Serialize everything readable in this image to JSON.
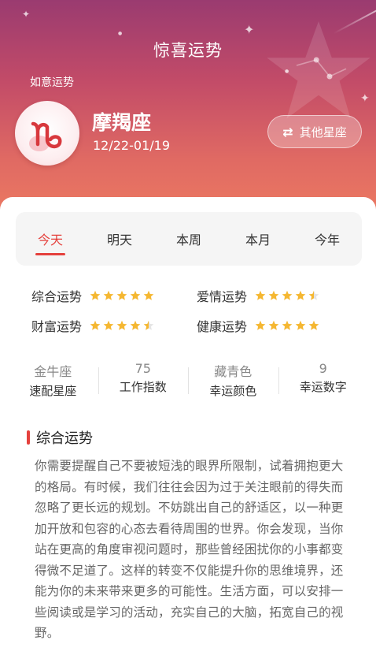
{
  "header": {
    "title": "惊喜运势",
    "section_tag": "如意运势",
    "sign_name": "摩羯座",
    "sign_symbol": "♑",
    "sign_dates": "12/22-01/19",
    "switch_label": "其他星座",
    "switch_icon": "swap-arrows-icon",
    "switch_glyph": "⇄"
  },
  "tabs": [
    {
      "label": "今天",
      "active": true
    },
    {
      "label": "明天",
      "active": false
    },
    {
      "label": "本周",
      "active": false
    },
    {
      "label": "本月",
      "active": false
    },
    {
      "label": "今年",
      "active": false
    }
  ],
  "fortunes": [
    {
      "label": "综合运势",
      "rating": 5
    },
    {
      "label": "爱情运势",
      "rating": 4.5
    },
    {
      "label": "财富运势",
      "rating": 4.5
    },
    {
      "label": "健康运势",
      "rating": 5
    }
  ],
  "stats": [
    {
      "value": "金牛座",
      "label": "速配星座"
    },
    {
      "value": "75",
      "label": "工作指数"
    },
    {
      "value": "藏青色",
      "label": "幸运颜色"
    },
    {
      "value": "9",
      "label": "幸运数字"
    }
  ],
  "overall": {
    "title": "综合运势",
    "text": "你需要提醒自己不要被短浅的眼界所限制，试着拥抱更大的格局。有时候，我们往往会因为过于关注眼前的得失而忽略了更长远的规划。不妨跳出自己的舒适区，以一种更加开放和包容的心态去看待周围的世界。你会发现，当你站在更高的角度审视问题时，那些曾经困扰你的小事都变得微不足道了。这样的转变不仅能提升你的思维境界，还能为你的未来带来更多的可能性。生活方面，可以安排一些阅读或是学习的活动，充实自己的大脑，拓宽自己的视野。"
  },
  "colors": {
    "accent": "#e5413d",
    "star_gold": "#f5b731",
    "star_empty": "#e4e4e4",
    "hero_top": "#9a3b70",
    "hero_bottom": "#ee7c62"
  }
}
